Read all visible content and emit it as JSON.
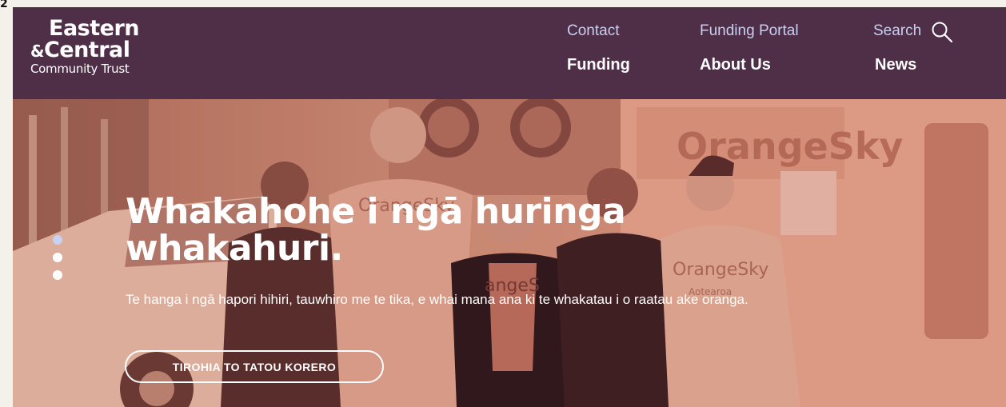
{
  "corner_mark": "2",
  "logo": {
    "line1": "Eastern",
    "line2_amp": "&",
    "line2": "Central",
    "line3": "Community Trust"
  },
  "nav": {
    "top": [
      {
        "label": "Contact"
      },
      {
        "label": "Funding Portal"
      },
      {
        "label": "Search"
      }
    ],
    "main": [
      {
        "label": "Funding"
      },
      {
        "label": "About Us"
      },
      {
        "label": "News"
      }
    ]
  },
  "hero": {
    "title_line1": "Whakahohe i ngā huringa",
    "title_line2": "whakahuri.",
    "subtitle": "Te hanga i ngā hapori hihiri, tauwhiro me te tika, e whai mana ana ki te whakatau i o raatau ake oranga.",
    "cta_label": "TIROHIA TO TATOU KORERO",
    "van_text": "OrangeSky",
    "shirt_texts": [
      "OrangeSky",
      "angeS",
      "OrangeSky",
      "Aotearoa"
    ],
    "slides": {
      "count": 3,
      "active": 1
    }
  },
  "colors": {
    "header_bg": "#4f2e48",
    "nav_top": "#c9cff0",
    "hero_tint": "#d08a70",
    "dot_active": "#c7d2f2"
  }
}
